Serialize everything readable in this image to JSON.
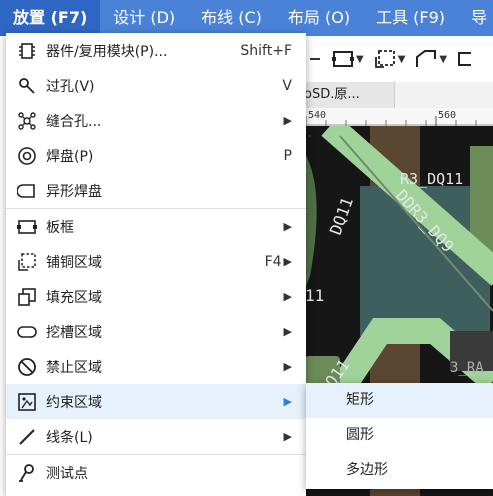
{
  "menubar": {
    "items": [
      {
        "label": "放置 (F7)"
      },
      {
        "label": "设计 (D)"
      },
      {
        "label": "布线 (C)"
      },
      {
        "label": "布局 (O)"
      },
      {
        "label": "工具 (F9)"
      },
      {
        "label": "导"
      }
    ]
  },
  "tab": {
    "label": "oSD.原..."
  },
  "ruler": {
    "ticks": [
      "540",
      "560"
    ]
  },
  "canvas": {
    "labels": [
      "R3_DQ11",
      "DQ11",
      "DDR3_DQ9",
      "11",
      "DQ11",
      "3_RA"
    ],
    "colors": {
      "bg": "#1b1b1b",
      "trace": "#9fd39a",
      "pad": "#5a7a52",
      "copper": "#8a6a42",
      "highlight": "#6f8fa0"
    }
  },
  "place_menu": {
    "items": [
      {
        "label": "器件/复用模块(P)...",
        "shortcut": "Shift+F",
        "icon": "component-icon",
        "submenu": false
      },
      {
        "label": "过孔(V)",
        "shortcut": "V",
        "icon": "via-icon",
        "submenu": false
      },
      {
        "label": "缝合孔...",
        "shortcut": "",
        "icon": "stitching-hole-icon",
        "submenu": true
      },
      {
        "label": "焊盘(P)",
        "shortcut": "P",
        "icon": "pad-icon",
        "submenu": false
      },
      {
        "label": "异形焊盘",
        "shortcut": "",
        "icon": "custom-pad-icon",
        "submenu": false
      },
      {
        "label": "板框",
        "shortcut": "",
        "icon": "board-outline-icon",
        "submenu": true
      },
      {
        "label": "铺铜区域",
        "shortcut": "F4",
        "icon": "copper-pour-icon",
        "submenu": true
      },
      {
        "label": "填充区域",
        "shortcut": "",
        "icon": "fill-region-icon",
        "submenu": true
      },
      {
        "label": "挖槽区域",
        "shortcut": "",
        "icon": "slot-region-icon",
        "submenu": true
      },
      {
        "label": "禁止区域",
        "shortcut": "",
        "icon": "keepout-region-icon",
        "submenu": true
      },
      {
        "label": "约束区域",
        "shortcut": "",
        "icon": "constraint-region-icon",
        "submenu": true
      },
      {
        "label": "线条(L)",
        "shortcut": "",
        "icon": "line-icon",
        "submenu": true
      },
      {
        "label": "测试点",
        "shortcut": "",
        "icon": "test-point-icon",
        "submenu": false
      }
    ]
  },
  "constraint_submenu": {
    "items": [
      {
        "label": "矩形"
      },
      {
        "label": "圆形"
      },
      {
        "label": "多边形"
      }
    ]
  }
}
